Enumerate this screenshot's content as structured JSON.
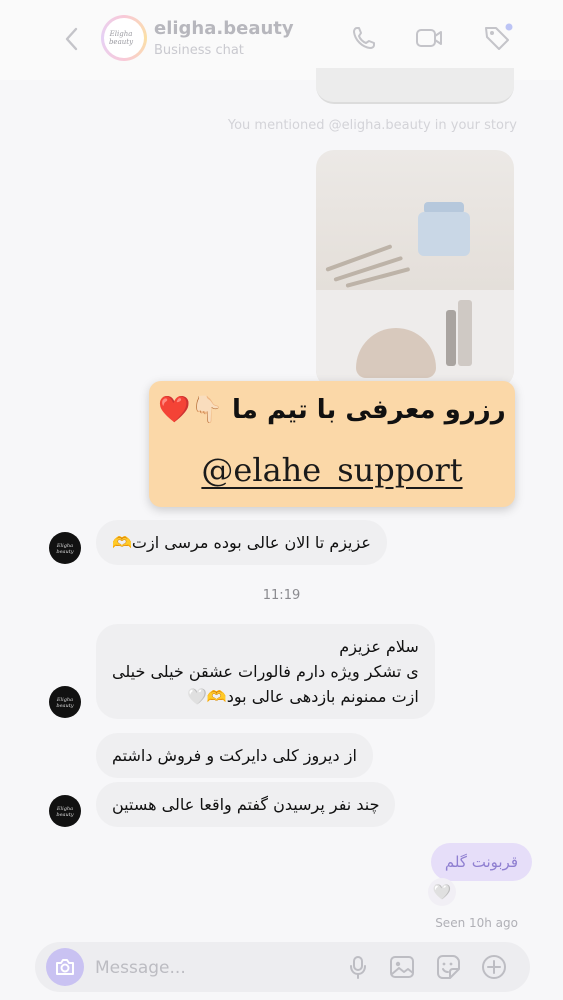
{
  "header": {
    "title": "eligha.beauty",
    "subtitle": "Business chat",
    "avatar_text": "Eligha beauty",
    "icons": [
      "back-chevron-icon",
      "phone-icon",
      "video-icon",
      "tag-icon"
    ]
  },
  "chat": {
    "mention_note": "You mentioned @eligha.beauty in your story",
    "story_banner": {
      "line1": "رزرو معرفی با تیم ما 👇🏻❤️",
      "handle": "@elahe_support"
    },
    "messages": [
      {
        "from": "business",
        "text": "عزیزم تا الان عالی بوده مرسی ازت🫶"
      },
      {
        "from": "business",
        "lines": [
          "سلام عزیزم",
          "ی تشکر ویژه دارم فالورات عشقن خیلی خیلی",
          "ازت ممنونم بازدهی عالی بود🫶🤍"
        ]
      },
      {
        "from": "business",
        "text": "از دیروز کلی دایرکت و فروش داشتم"
      },
      {
        "from": "business",
        "text": "چند نفر پرسیدن گفتم واقعا عالی هستین"
      },
      {
        "from": "me",
        "text": "قربونت گلم"
      }
    ],
    "timestamp": "11:19",
    "reaction": "🤍",
    "seen": "Seen 10h ago"
  },
  "composer": {
    "placeholder": "Message...",
    "icons": [
      "camera-icon",
      "microphone-icon",
      "gallery-icon",
      "sticker-icon",
      "plus-icon"
    ]
  },
  "colors": {
    "banner_bg": "#fbd8a8",
    "outgoing_bubble": "#e6def9",
    "outgoing_text": "#8f7fd1",
    "incoming_bubble": "#efeff1",
    "camera_button": "#c9c2f2"
  }
}
